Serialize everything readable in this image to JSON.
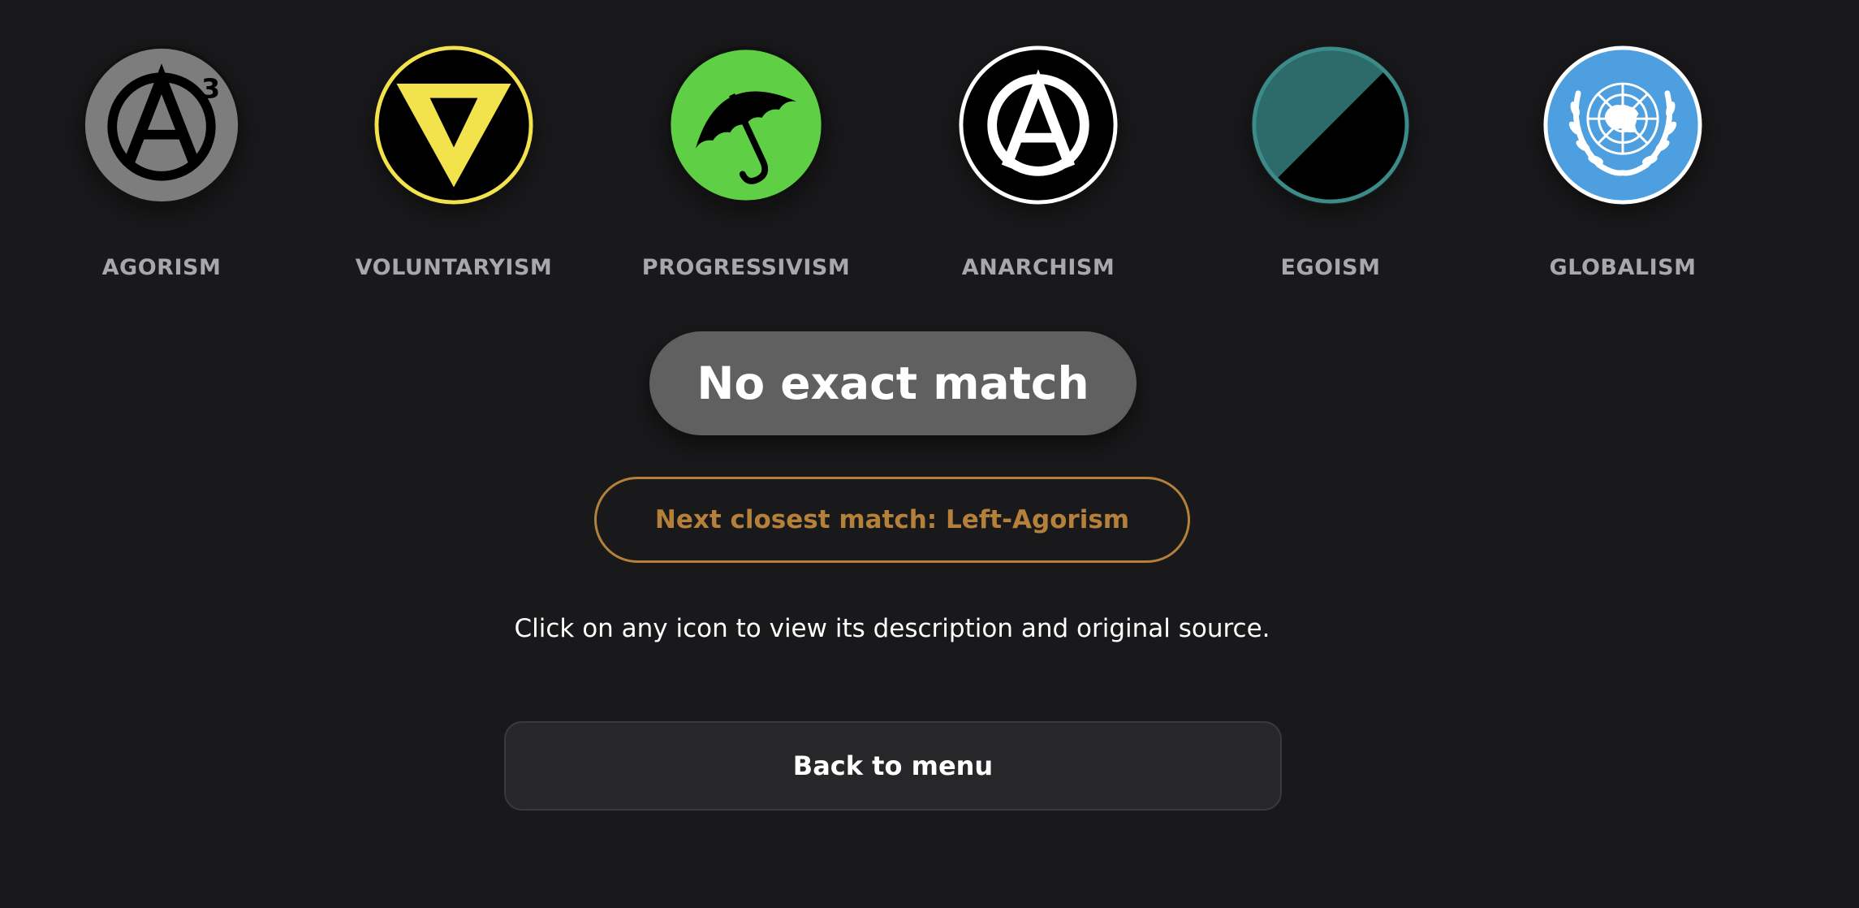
{
  "ideologies": [
    {
      "label": "AGORISM",
      "icon": "agorism-icon",
      "colors": {
        "background": "#7d7d7d",
        "symbol": "#000000"
      }
    },
    {
      "label": "VOLUNTARYISM",
      "icon": "voluntaryism-icon",
      "colors": {
        "background": "#000000",
        "symbol": "#f2e34c"
      }
    },
    {
      "label": "PROGRESSIVISM",
      "icon": "progressivism-icon",
      "colors": {
        "background": "#5fcf45",
        "symbol": "#000000"
      }
    },
    {
      "label": "ANARCHISM",
      "icon": "anarchism-icon",
      "colors": {
        "background": "#000000",
        "symbol": "#ffffff"
      }
    },
    {
      "label": "EGOISM",
      "icon": "egoism-icon",
      "colors": {
        "background": "#2d6b6a",
        "symbol": "#000000"
      }
    },
    {
      "label": "GLOBALISM",
      "icon": "globalism-icon",
      "colors": {
        "background": "#4e9fdf",
        "symbol": "#ffffff"
      }
    }
  ],
  "result": {
    "headline": "No exact match",
    "next_closest": "Next closest match: Left-Agorism"
  },
  "hint": "Click on any icon to view its description and original source.",
  "back_button": "Back to menu",
  "colors": {
    "page_background": "#19191b",
    "label_gray": "#a7a7ae",
    "pill_gray": "#606060",
    "accent_amber": "#b5813a"
  }
}
